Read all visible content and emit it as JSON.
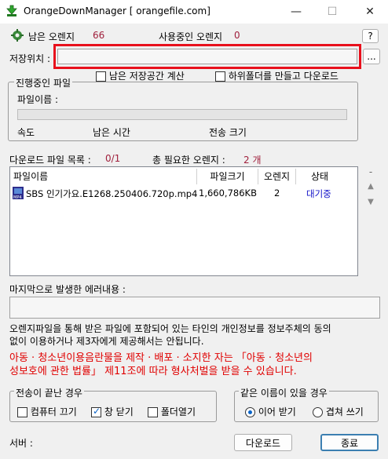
{
  "window": {
    "title": "OrangeDownManager [          orangefile.com]",
    "minimize_glyph": "—",
    "maximize_glyph": "☐",
    "close_glyph": "✕"
  },
  "capacity": {
    "remaining_label": "남은 오렌지",
    "remaining_value": "66",
    "in_use_label": "사용중인 오렌지",
    "in_use_value": "0",
    "help_label": "?"
  },
  "save": {
    "label": "저장위치 :",
    "path": "",
    "browse_label": "...",
    "option_check_space": "남은 저장공간 계산",
    "option_subfolder": "하위폴더를 만들고 다운로드"
  },
  "progress": {
    "group_label": "진행중인 파일",
    "filename_label": "파일이름 :",
    "progress_fraction": 0,
    "speed_label": "속도",
    "time_left_label": "남은 시간",
    "transfer_size_label": "전송 크기"
  },
  "download_list": {
    "count_label": "다운로드 파일 목록 :",
    "count_value": "0/1",
    "total_label": "총 필요한 오렌지 :",
    "total_value": "2 개",
    "columns": [
      "파일이름",
      "파일크기",
      "오렌지",
      "상태"
    ],
    "rows": [
      {
        "filename": "SBS 인기가요.E1268.250406.720p.mp4",
        "size": "1,660,786KB",
        "orange": "2",
        "status": "대기중"
      }
    ],
    "side_minus": "-",
    "side_up": "▲",
    "side_down": "▼"
  },
  "error": {
    "label": "마지막으로 발생한 에러내용 :",
    "value": ""
  },
  "notices": {
    "privacy": [
      "오렌지파일을 통해 받은 파일에 포함되어 있는 타인의 개인정보를 정보주체의 동의",
      "없이 이용하거나 제3자에게 제공해서는 안됩니다."
    ],
    "warning": [
      "아동 · 청소년이용음란물을 제작 · 배포 · 소지한 자는 「아동 · 청소년의",
      "성보호에 관한 법률」 제11조에 따라 형사처벌을 받을 수 있습니다."
    ]
  },
  "after_transfer": {
    "group_label": "전송이 끝난 경우",
    "pc_off": "컴퓨터 끄기",
    "close_window": "창 닫기",
    "open_folder": "폴더열기"
  },
  "same_name": {
    "group_label": "같은 이름이 있을 경우",
    "resume": "이어 받기",
    "overwrite": "겹쳐 쓰기"
  },
  "footer": {
    "server_label": "서버 :",
    "download_button": "다운로드",
    "exit_button": "종료"
  },
  "colors": {
    "highlight_box": "#e8101c",
    "accent": "#0a64c8"
  }
}
